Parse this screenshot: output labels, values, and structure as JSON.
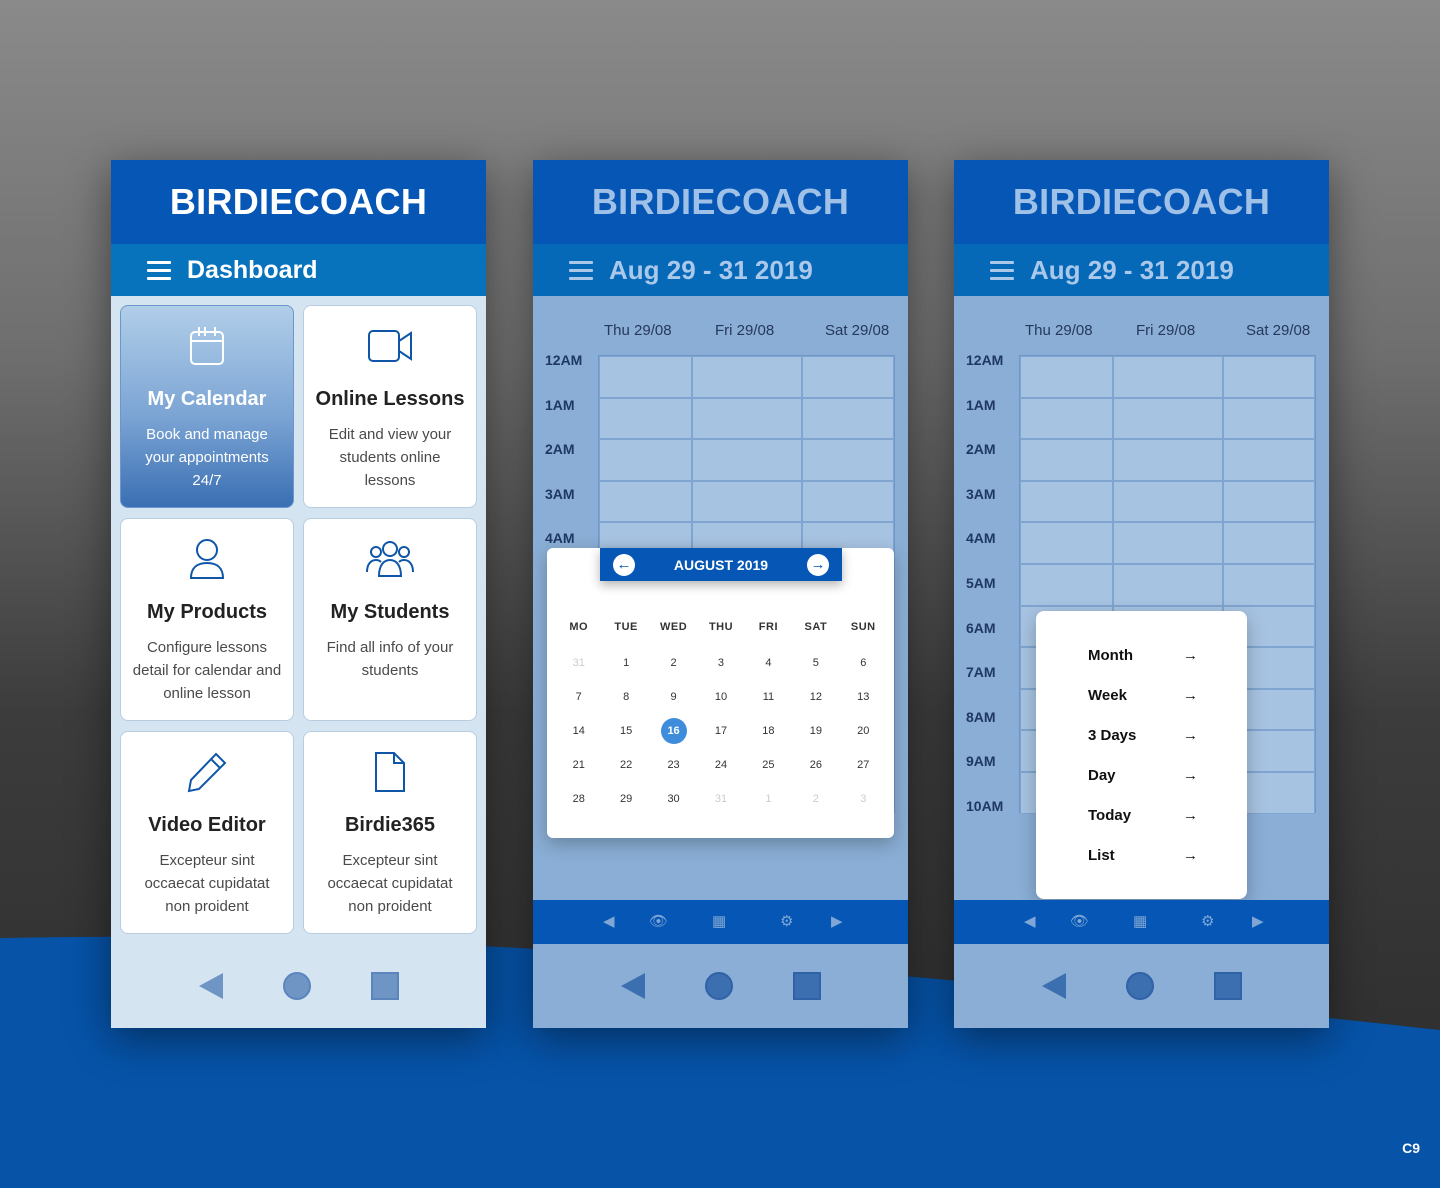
{
  "colors": {
    "brand": "#0657b5",
    "subbar": "#0773bd",
    "accent": "#3e8cdc"
  },
  "dashboard": {
    "brand": "BIRDIECOACH",
    "title": "Dashboard",
    "cards": [
      {
        "icon": "calendar-icon",
        "title": "My Calendar",
        "desc": "Book and manage your appointments 24/7"
      },
      {
        "icon": "video-camera-icon",
        "title": "Online Lessons",
        "desc": "Edit and view your students online lessons"
      },
      {
        "icon": "user-icon",
        "title": "My Products",
        "desc": "Configure lessons detail for calendar and online lesson"
      },
      {
        "icon": "group-icon",
        "title": "My Students",
        "desc": "Find all info of your students"
      },
      {
        "icon": "pencil-icon",
        "title": "Video Editor",
        "desc": "Excepteur sint occaecat cupidatat non proident"
      },
      {
        "icon": "document-icon",
        "title": "Birdie365",
        "desc": "Excepteur sint occaecat cupidatat non proident"
      }
    ]
  },
  "calendar": {
    "brand": "BIRDIECOACH",
    "range": "Aug 29 - 31 2019",
    "days": [
      "Thu 29/08",
      "Fri 29/08",
      "Sat 29/08"
    ],
    "times": [
      "12AM",
      "1AM",
      "2AM",
      "3AM",
      "4AM",
      "5AM",
      "6AM",
      "7AM",
      "8AM",
      "9AM",
      "10AM"
    ],
    "toolbar": [
      "◀",
      "👁",
      "▦",
      "⚙",
      "▶"
    ]
  },
  "picker": {
    "month": "AUGUST 2019",
    "prev": "←",
    "next": "→",
    "weekdays": [
      "MO",
      "TUE",
      "WED",
      "THU",
      "FRI",
      "SAT",
      "SUN"
    ],
    "weeks": [
      [
        "31",
        "1",
        "2",
        "3",
        "4",
        "5",
        "6"
      ],
      [
        "7",
        "8",
        "9",
        "10",
        "11",
        "12",
        "13"
      ],
      [
        "14",
        "15",
        "16",
        "17",
        "18",
        "19",
        "20"
      ],
      [
        "21",
        "22",
        "23",
        "24",
        "25",
        "26",
        "27"
      ],
      [
        "28",
        "29",
        "30",
        "31",
        "1",
        "2",
        "3"
      ]
    ],
    "selected": "16"
  },
  "menu": {
    "items": [
      "Month",
      "Week",
      "3 Days",
      "Day",
      "Today",
      "List"
    ],
    "arrow": "→"
  },
  "corner_label": "C9"
}
